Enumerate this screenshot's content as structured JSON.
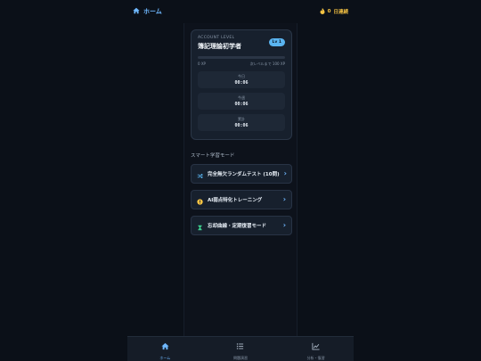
{
  "header": {
    "home_label": "ホーム",
    "streak_count": "0",
    "streak_label": "日連続"
  },
  "account": {
    "label": "ACCOUNT LEVEL",
    "title": "簿記理論初学者",
    "level_badge": "Lv 1",
    "xp_progress": 0,
    "xp_current": "0 XP",
    "xp_next": "次レベルまで 100 XP"
  },
  "stats": [
    {
      "label": "今日",
      "value": "00:06"
    },
    {
      "label": "今週",
      "value": "00:06"
    },
    {
      "label": "累計",
      "value": "00:06"
    }
  ],
  "section_title": "スマート学習モード",
  "modes": [
    {
      "label": "完全無欠ランダムテスト (10問)",
      "icon": "shuffle-icon",
      "color": "#5ab4f0"
    },
    {
      "label": "AI弱点特化トレーニング",
      "icon": "warning-icon",
      "color": "#f6c343"
    },
    {
      "label": "忘却曲線・定期復習モード",
      "icon": "hourglass-icon",
      "color": "#3ecf8e"
    }
  ],
  "nav": [
    {
      "label": "ホーム",
      "icon": "home-icon"
    },
    {
      "label": "問題演習",
      "icon": "list-icon"
    },
    {
      "label": "分析・復習",
      "icon": "chart-icon"
    }
  ]
}
